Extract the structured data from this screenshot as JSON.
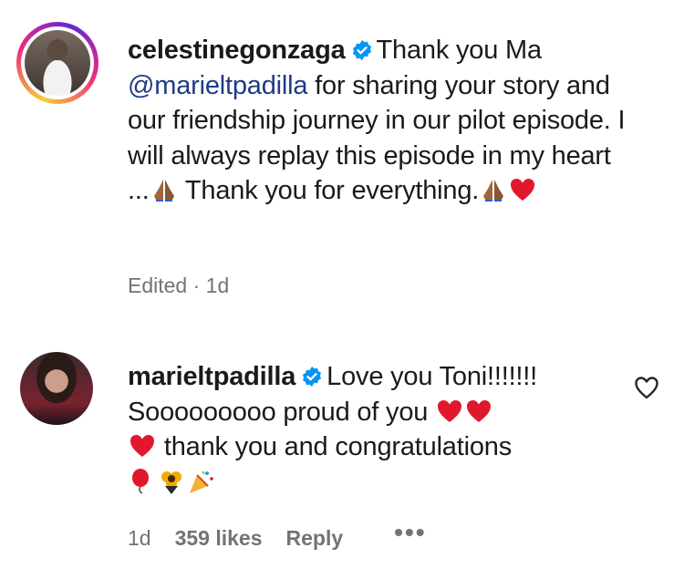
{
  "comments": [
    {
      "username": "celestinegonzaga",
      "text_before_mention": "Thank you Ma",
      "mention": "@marieltpadilla",
      "text_after_mention": " for sharing your story and our friendship journey in our pilot episode. I will always replay this episode in my heart ...",
      "text_mid": " Thank you for everything.",
      "meta": "Edited · 1d",
      "emojis": [
        "folded-hands",
        "folded-hands",
        "red-heart"
      ]
    },
    {
      "username": "marieltpadilla",
      "text_1": "Love you Toni!!!!!!!",
      "text_2": "Sooooooooo proud of you",
      "text_3": " thank you and congratulations",
      "time": "1d",
      "likes": "359 likes",
      "reply": "Reply",
      "more": "•••",
      "emojis": [
        "red-heart",
        "red-heart",
        "red-heart",
        "balloon",
        "bouquet",
        "party-popper"
      ]
    }
  ],
  "colors": {
    "verified": "#0095f6",
    "mention": "#1f3b86",
    "meta": "#737373",
    "heart": "#e0182d"
  }
}
